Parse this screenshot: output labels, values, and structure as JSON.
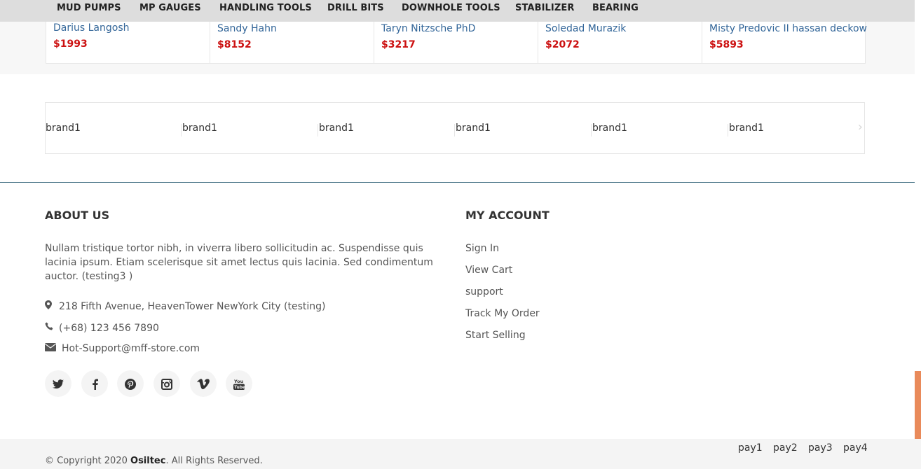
{
  "topnav": {
    "items": [
      "MUD PUMPS",
      "MP GAUGES",
      "HANDLING TOOLS",
      "DRILL BITS",
      "DOWNHOLE TOOLS",
      "STABILIZER",
      "BEARING"
    ]
  },
  "products": [
    {
      "name": "Darius Langosh",
      "price": "$1993"
    },
    {
      "name": "Sandy Hahn",
      "price": "$8152"
    },
    {
      "name": "Taryn Nitzsche PhD",
      "price": "$3217"
    },
    {
      "name": "Soledad Murazik",
      "price": "$2072"
    },
    {
      "name": "Misty Predovic II hassan deckow",
      "price": "$5893"
    }
  ],
  "brands": {
    "items": [
      "brand1",
      "brand1",
      "brand1",
      "brand1",
      "brand1",
      "brand1"
    ],
    "next_icon": "›"
  },
  "about": {
    "title": "ABOUT US",
    "text": "Nullam tristique tortor nibh, in viverra libero sollicitudin ac. Suspendisse quis lacinia ipsum. Etiam scelerisque sit amet lectus quis lacinia. Sed condimentum auctor. (testing3 )",
    "address": "218 Fifth Avenue, HeavenTower NewYork City (testing)",
    "phone": "(+68) 123 456 7890",
    "email": "Hot-Support@mff-store.com",
    "icons": {
      "address": "map-marker-icon",
      "phone": "phone-icon",
      "email": "envelope-icon"
    }
  },
  "social": [
    {
      "name": "twitter-icon",
      "glyph": "t"
    },
    {
      "name": "facebook-icon",
      "glyph": "f"
    },
    {
      "name": "pinterest-icon",
      "glyph": "P"
    },
    {
      "name": "instagram-icon",
      "glyph": "◘"
    },
    {
      "name": "vimeo-icon",
      "glyph": "v"
    },
    {
      "name": "youtube-icon",
      "glyph": "▶"
    }
  ],
  "account": {
    "title": "MY ACCOUNT",
    "links": [
      "Sign In",
      "View Cart",
      "support",
      "Track My Order",
      "Start Selling"
    ]
  },
  "footer": {
    "copyright_prefix": "© Copyright 2020 ",
    "brand": "Osiltec",
    "copyright_suffix": ". All Rights Reserved.",
    "payments": [
      "pay1",
      "pay2",
      "pay3",
      "pay4"
    ]
  },
  "colors": {
    "price": "#cc1111",
    "product_link": "#336699",
    "divider": "#3b6a7e",
    "scroll_accent": "#e98a5a"
  }
}
